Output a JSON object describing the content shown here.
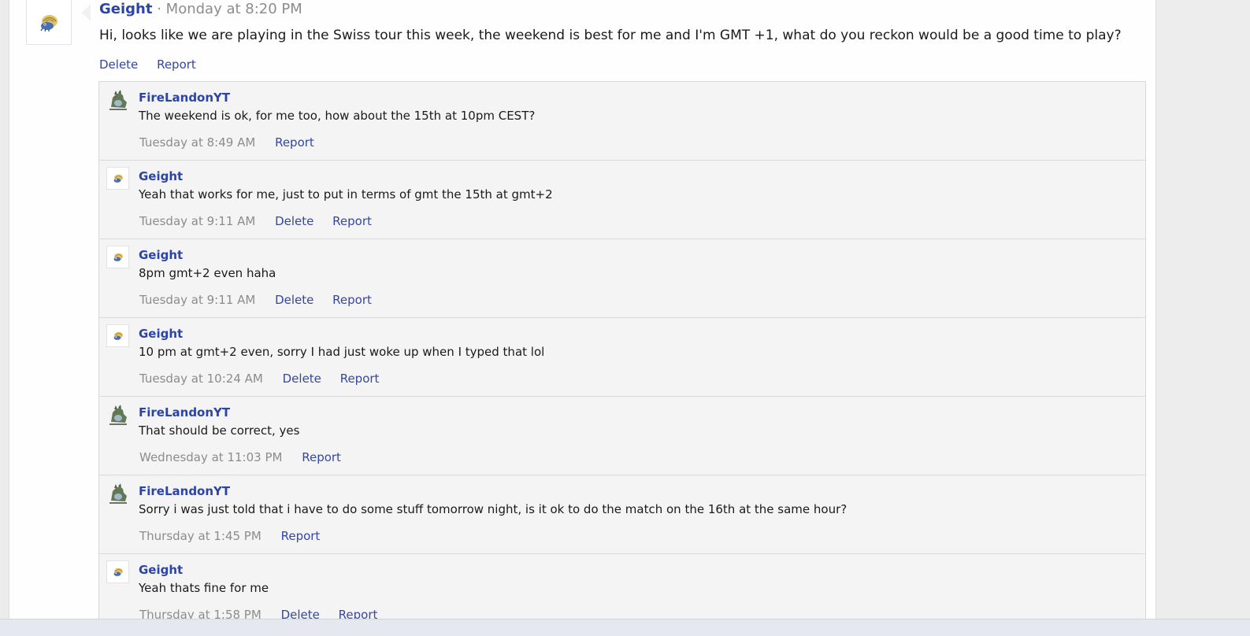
{
  "post": {
    "author": "Geight",
    "separator": "·",
    "time": "Monday at 8:20 PM",
    "body": "Hi, looks like we are playing in the Swiss tour this week, the weekend is best for me and I'm GMT +1, what do you reckon would be a good time to play?",
    "delete_label": "Delete",
    "report_label": "Report"
  },
  "replies": [
    {
      "author": "FireLandonYT",
      "text": "The weekend is ok, for me too, how about the 15th at 10pm CEST?",
      "time": "Tuesday at 8:49 AM",
      "report_label": "Report"
    },
    {
      "author": "Geight",
      "text": "Yeah that works for me, just to put in terms of gmt the 15th at gmt+2",
      "time": "Tuesday at 9:11 AM",
      "delete_label": "Delete",
      "report_label": "Report"
    },
    {
      "author": "Geight",
      "text": "8pm gmt+2 even haha",
      "time": "Tuesday at 9:11 AM",
      "delete_label": "Delete",
      "report_label": "Report"
    },
    {
      "author": "Geight",
      "text": "10 pm at gmt+2 even, sorry I had just woke up when I typed that lol",
      "time": "Tuesday at 10:24 AM",
      "delete_label": "Delete",
      "report_label": "Report"
    },
    {
      "author": "FireLandonYT",
      "text": "That should be correct, yes",
      "time": "Wednesday at 11:03 PM",
      "report_label": "Report"
    },
    {
      "author": "FireLandonYT",
      "text": "Sorry i was just told that i have to do some stuff tomorrow night, is it ok to do the match on the 16th at the same hour?",
      "time": "Thursday at 1:45 PM",
      "report_label": "Report"
    },
    {
      "author": "Geight",
      "text": "Yeah thats fine for me",
      "time": "Thursday at 1:58 PM",
      "delete_label": "Delete",
      "report_label": "Report"
    }
  ],
  "colors": {
    "link": "#3447a3",
    "author": "#2b44a6",
    "meta": "#8c8c8c"
  }
}
